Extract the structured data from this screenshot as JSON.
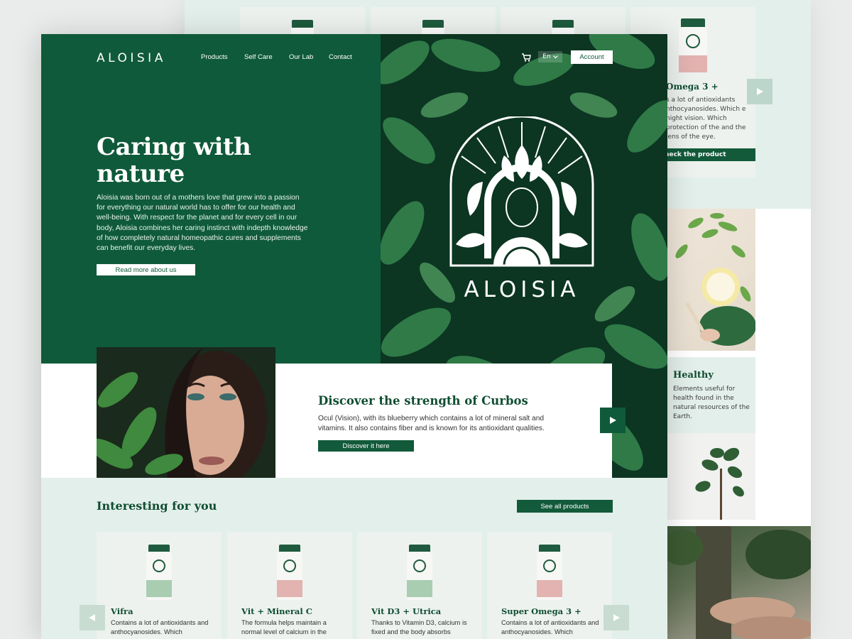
{
  "nav": {
    "logo": "ALOISIA",
    "links": [
      "Products",
      "Self Care",
      "Our Lab",
      "Contact"
    ],
    "language": "En",
    "account_label": "Account"
  },
  "hero": {
    "title": "Caring with nature",
    "description": "Aloisia was born out of a mothers love that grew into a passion for everything our natural world has to offer for our health and well-being. With respect for the planet and for every cell in our body, Aloisia combines her caring instinct with indepth knowledge of how completely natural homeopathic cures and supplements can benefit our everyday lives.",
    "button_label": "Read more about us",
    "emblem_text": "ALOISIA"
  },
  "discover": {
    "title": "Discover the strength of Curbos",
    "description": "Ocul (Vision), with its blueberry which contains a lot of mineral salt and vitamins. It also contains fiber and is known for its antioxidant qualities.",
    "button_label": "Discover it here"
  },
  "interesting": {
    "title": "Interesting for you",
    "see_all_label": "See all products",
    "products": [
      {
        "name": "Vifra",
        "description": "Contains a lot of antioxidants and anthocyanosides. Which",
        "label_color": "#a9cdb1"
      },
      {
        "name": "Vit + Mineral C",
        "description": "The formula helps maintain a normal level of calcium in the",
        "label_color": "#e2b3b0"
      },
      {
        "name": "Vit D3 + Utrica",
        "description": "Thanks to Vitamin D3, calcium is fixed and the body absorbs",
        "label_color": "#a9cdb1"
      },
      {
        "name": "Super Omega 3 +",
        "description": "Contains a lot of antioxidants and anthocyanosides. Which",
        "label_color": "#e2b3b0"
      }
    ]
  },
  "background_page": {
    "product_title": "Omega 3 +",
    "product_desc": "s a lot of antioxidants nthocyanosides. Which e night vision. Which protection of the and the lens of the eye.",
    "check_label": "Check the product",
    "healthy_title": "Healthy",
    "healthy_desc": "Elements useful for health found in the natural resources of the Earth."
  },
  "colors": {
    "brand_green": "#0f5a3a",
    "dark_green": "#0d3a25",
    "mint": "#e3efea",
    "pink_label": "#e2b3b0",
    "green_label": "#a9cdb1"
  }
}
